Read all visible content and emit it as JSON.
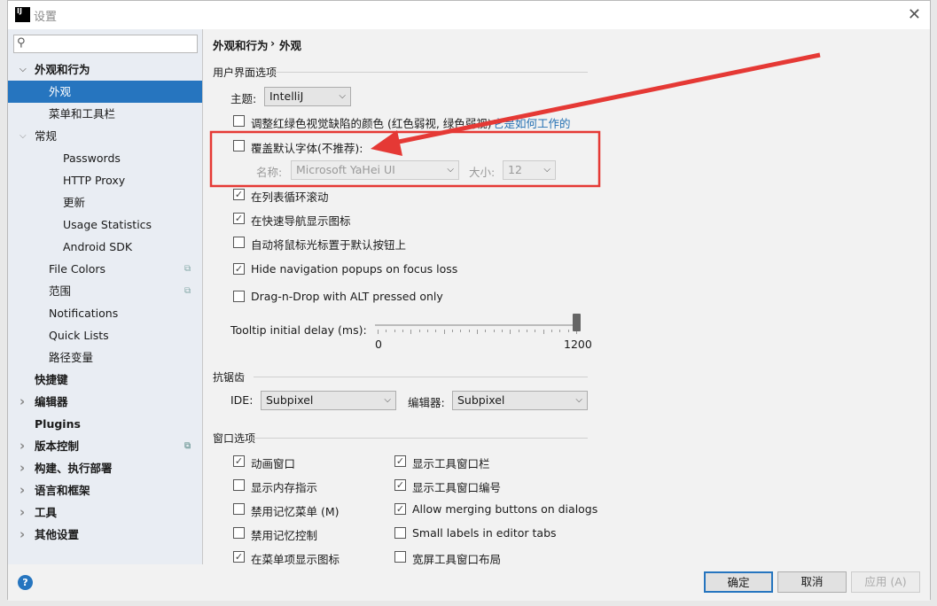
{
  "window": {
    "title": "设置",
    "logo": "IJ",
    "close_icon": "close-icon"
  },
  "search": {
    "placeholder": "",
    "value": ""
  },
  "sidebar": {
    "items": [
      {
        "label": "外观和行为",
        "expanded": true,
        "bold": true
      },
      {
        "label": "外观",
        "selected": true
      },
      {
        "label": "菜单和工具栏"
      },
      {
        "label": "常规",
        "expanded": true
      },
      {
        "label": "Passwords"
      },
      {
        "label": "HTTP Proxy"
      },
      {
        "label": "更新"
      },
      {
        "label": "Usage Statistics"
      },
      {
        "label": "Android SDK"
      },
      {
        "label": "File Colors",
        "copy": true
      },
      {
        "label": "范围",
        "copy": true
      },
      {
        "label": "Notifications"
      },
      {
        "label": "Quick Lists"
      },
      {
        "label": "路径变量"
      },
      {
        "label": "快捷键",
        "bold": true
      },
      {
        "label": "编辑器",
        "bold": true,
        "collapsed": true
      },
      {
        "label": "Plugins",
        "bold": true
      },
      {
        "label": "版本控制",
        "bold": true,
        "collapsed": true,
        "copy": true
      },
      {
        "label": "构建、执行部署",
        "bold": true,
        "collapsed": true
      },
      {
        "label": "语言和框架",
        "bold": true,
        "collapsed": true
      },
      {
        "label": "工具",
        "bold": true,
        "collapsed": true
      },
      {
        "label": "其他设置",
        "bold": true,
        "collapsed": true
      }
    ]
  },
  "breadcrumb": {
    "parent": "外观和行为",
    "sep": "›",
    "current": "外观"
  },
  "ui_options": {
    "header": "用户界面选项",
    "theme_label": "主题:",
    "theme_value": "IntelliJ",
    "colorblind": {
      "label": "调整红绿色视觉缺陷的颜色 (红色弱视, 绿色弱视)",
      "checked": false,
      "link": "它是如何工作的"
    },
    "override_font": {
      "label": "覆盖默认字体(不推荐):",
      "checked": false,
      "name_label": "名称:",
      "name_value": "Microsoft YaHei UI",
      "size_label": "大小:",
      "size_value": "12"
    },
    "checks": [
      {
        "label": "在列表循环滚动",
        "checked": true
      },
      {
        "label": "在快速导航显示图标",
        "checked": true
      },
      {
        "label": "自动将鼠标光标置于默认按钮上",
        "checked": false
      },
      {
        "label": "Hide navigation popups on focus loss",
        "checked": true
      },
      {
        "label": "Drag-n-Drop with ALT pressed only",
        "checked": false
      }
    ],
    "tooltip": {
      "label": "Tooltip initial delay (ms):",
      "min": "0",
      "max": "1200",
      "value": 1200
    }
  },
  "antialias": {
    "header": "抗锯齿",
    "ide_label": "IDE:",
    "ide_value": "Subpixel",
    "editor_label": "编辑器:",
    "editor_value": "Subpixel"
  },
  "window_options": {
    "header": "窗口选项",
    "left": [
      {
        "label": "动画窗口",
        "checked": true
      },
      {
        "label": "显示内存指示",
        "checked": false
      },
      {
        "label": "禁用记忆菜单 (M)",
        "checked": false
      },
      {
        "label": "禁用记忆控制",
        "checked": false
      },
      {
        "label": "在菜单项显示图标",
        "checked": true
      }
    ],
    "right": [
      {
        "label": "显示工具窗口栏",
        "checked": true
      },
      {
        "label": "显示工具窗口编号",
        "checked": true
      },
      {
        "label": "Allow merging buttons on dialogs",
        "checked": true
      },
      {
        "label": "Small labels in editor tabs",
        "checked": false
      },
      {
        "label": "宽屏工具窗口布局",
        "checked": false
      }
    ]
  },
  "buttons": {
    "ok": "确定",
    "cancel": "取消",
    "apply": "应用 (A)"
  },
  "colors": {
    "accent": "#2675bf",
    "annotation": "#e53935",
    "link": "#2470b3"
  }
}
